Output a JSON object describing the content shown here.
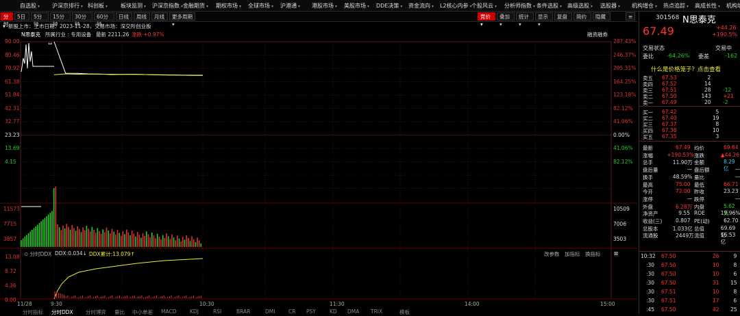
{
  "topnav": [
    {
      "label": "自选股",
      "x": 29
    },
    {
      "label": "沪深京排行",
      "x": 76
    },
    {
      "label": "科创板",
      "x": 128
    },
    {
      "label": "板块监测",
      "x": 176
    },
    {
      "label": "沪深京指数",
      "x": 222
    },
    {
      "label": "金融期货",
      "x": 267
    },
    {
      "label": "期权市场",
      "x": 315
    },
    {
      "label": "全球市场",
      "x": 362
    },
    {
      "label": "沪港通",
      "x": 409
    },
    {
      "label": "港股市场",
      "x": 455
    },
    {
      "label": "美股市场",
      "x": 502
    },
    {
      "label": "DDE决策",
      "x": 549
    },
    {
      "label": "资金流向",
      "x": 596
    },
    {
      "label": "L2核心内参",
      "x": 642
    },
    {
      "label": "个股风云",
      "x": 688
    },
    {
      "label": "分析师指数",
      "x": 736
    },
    {
      "label": "条件选股",
      "x": 783
    },
    {
      "label": "高级选股",
      "x": 828
    },
    {
      "label": "选股器",
      "x": 876
    },
    {
      "label": "机构增仓",
      "x": 922
    },
    {
      "label": "热点追踪",
      "x": 968
    },
    {
      "label": "高成长性",
      "x": 1014
    },
    {
      "label": "机构增",
      "x": 1060
    }
  ],
  "toolbar": {
    "periods": [
      "分时",
      "5日",
      "5分钟",
      "15分钟",
      "30分钟",
      "60分钟",
      "日线",
      "周线",
      "月线",
      "更多周期"
    ],
    "right_buttons": [
      "竞价",
      "叠加",
      "统计",
      "显示",
      "复盘",
      "简约",
      "隐藏"
    ]
  },
  "info": {
    "line1_a": "新股上市：上市日期：2023-11-28，交易市场：深交所创业板",
    "name": "N思泰克",
    "industry": "所属行业 : 专用设备",
    "latest": "最新 2211.26",
    "change": "涨跌 +0.97%",
    "right": "融资融券"
  },
  "axis": {
    "left_prices": [
      "90.00",
      "80.46",
      "70.92",
      "61.38",
      "51.84",
      "42.31",
      "32.77",
      "23.23",
      "13.69",
      "4.15"
    ],
    "right_pcts_red": [
      "287.43%",
      "246.37%",
      "205.31%",
      "164.25%",
      "123.18%",
      "82.12%",
      "41.06%"
    ],
    "right_zero": "0.00%",
    "right_pcts_green": [
      "41.06%",
      "82.12%"
    ],
    "vol_left": [
      "11573",
      "7715",
      "3857"
    ],
    "vol_right": [
      "10509",
      "7006",
      "3503"
    ],
    "ddx_left": [
      "13.08",
      "8.72",
      "4.36",
      "0.00"
    ],
    "time_labels": [
      "11/28",
      "9:30",
      "10:30",
      "11:30",
      "14:00",
      "15:00"
    ]
  },
  "ddx": {
    "title": "分时DDX",
    "ddx": "DDX:0.034",
    "ddx_total": "DDX累计:13.079",
    "buttons": [
      "改参数",
      "加指标",
      "换指标"
    ]
  },
  "bottom_tabs": [
    "分时指标",
    "分时DDX",
    "分时博弈",
    "量比",
    "中小单差",
    "MACD",
    "KDJ",
    "RSI",
    "BRAR",
    "DMI",
    "CR",
    "PSY",
    "KD",
    "DMA",
    "TRIX",
    "模板"
  ],
  "chart_data": {
    "type": "line",
    "x": [
      "9:30",
      "9:35",
      "9:40",
      "9:45",
      "9:50",
      "9:55",
      "10:00",
      "10:05",
      "10:10",
      "10:15",
      "10:20",
      "10:25",
      "10:30",
      "10:35"
    ],
    "series": [
      {
        "values": [
          90,
          70.9,
          70.8,
          70.5,
          70.4,
          70.1,
          70.2,
          70.3,
          70.1,
          69.9,
          69.8,
          69.7,
          69.6,
          69.6
        ]
      },
      {
        "values": [
          70,
          70.5,
          70.3,
          70.4,
          70.3,
          70.3,
          70.2,
          70.2,
          70.1,
          70.0,
          69.9,
          69.8,
          69.7,
          69.7
        ]
      }
    ],
    "ylim": [
      4.15,
      90.0
    ]
  },
  "rp": {
    "code": "301568",
    "name": "N思泰克",
    "price": "67.49",
    "chg": "+44.26",
    "pct": "+190.5%",
    "status_label": "交易状态",
    "status": "交易中",
    "weibi_label": "委比",
    "weibi": "-64.26%",
    "weicha_label": "委差",
    "weicha": "-162",
    "banner": "什么是价格笼子？点击查看",
    "sells": [
      {
        "l": "卖五",
        "p": "67.53",
        "v": "2",
        "d": ""
      },
      {
        "l": "卖四",
        "p": "67.52",
        "v": "14",
        "d": ""
      },
      {
        "l": "卖三",
        "p": "67.51",
        "v": "28",
        "d": "-12"
      },
      {
        "l": "卖二",
        "p": "67.50",
        "v": "143",
        "d": "+21"
      },
      {
        "l": "卖一",
        "p": "67.49",
        "v": "20",
        "d": "-2"
      }
    ],
    "buys": [
      {
        "l": "买一",
        "p": "67.42",
        "v": "5"
      },
      {
        "l": "买二",
        "p": "67.40",
        "v": "19"
      },
      {
        "l": "买三",
        "p": "67.37",
        "v": "8"
      },
      {
        "l": "买四",
        "p": "67.36",
        "v": "10"
      },
      {
        "l": "买五",
        "p": "67.35",
        "v": "3"
      }
    ],
    "stats": [
      [
        "最新",
        "67.49",
        "r",
        "均价",
        "69.64",
        "r"
      ],
      [
        "涨幅",
        "+190.53%",
        "r",
        "涨跌",
        "▲44.26",
        "r"
      ],
      [
        "总手",
        "11.90万",
        "w",
        "金额",
        "8.29亿",
        "c"
      ],
      [
        "盘后量",
        "—",
        "w",
        "盘后额",
        "—",
        "w"
      ],
      [
        "换手",
        "48.59%",
        "w",
        "量比",
        "—",
        "w"
      ],
      [
        "最高",
        "75.00",
        "r",
        "最低",
        "66.71",
        "r"
      ],
      [
        "今开",
        "72.00",
        "r",
        "昨收",
        "23.23",
        "w"
      ],
      [
        "涨停",
        "—",
        "w",
        "跌停",
        "—",
        "w"
      ],
      [
        "外盘",
        "6.28万",
        "r",
        "内盘",
        "5.62万",
        "g"
      ],
      [
        "净资产",
        "9.55",
        "w",
        "ROE",
        "19.96%",
        "w"
      ],
      [
        "收益(三)",
        "0.807",
        "w",
        "PE(动)",
        "62.70",
        "w"
      ],
      [
        "总股本",
        "1.033亿",
        "w",
        "总值",
        "69.69亿",
        "w"
      ],
      [
        "流通股",
        "2449万",
        "w",
        "流值",
        "16.53亿",
        "w"
      ]
    ],
    "ticks": [
      [
        "10:32",
        "67.50",
        "26",
        "9"
      ],
      [
        ":30",
        "67.50",
        "10",
        "8"
      ],
      [
        ":30",
        "67.50",
        "10",
        "6"
      ],
      [
        ":30",
        "67.50",
        "31",
        "15"
      ],
      [
        ":30",
        "67.51",
        "10",
        "8"
      ],
      [
        ":30",
        "67.51",
        "17",
        "6"
      ],
      [
        ":45",
        "67.50",
        "42",
        "25"
      ]
    ]
  }
}
